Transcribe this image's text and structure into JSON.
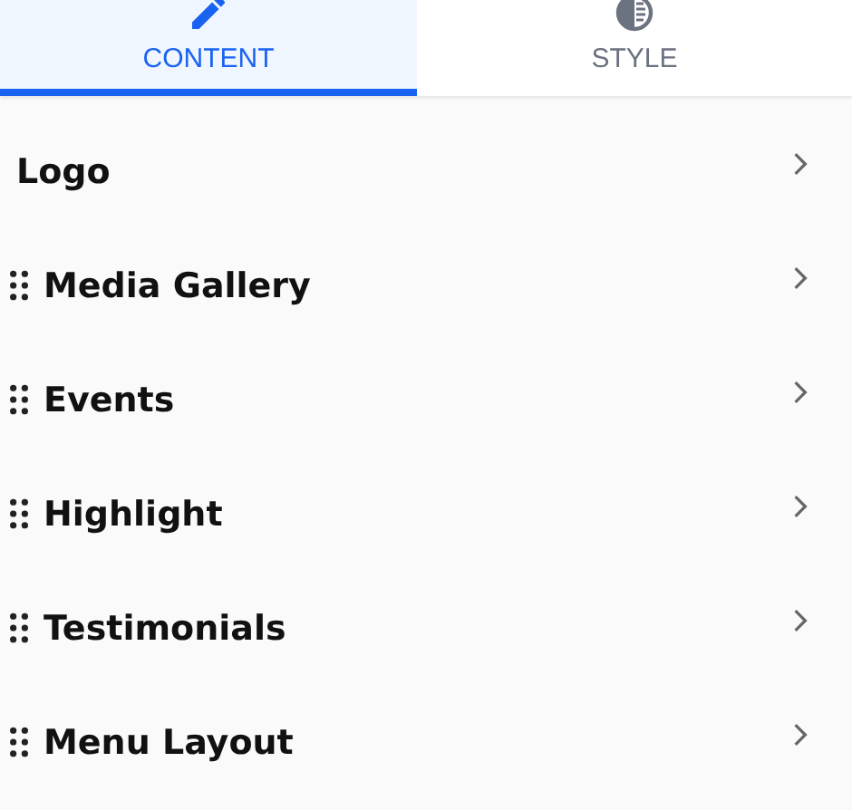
{
  "tabs": [
    {
      "label": "CONTENT",
      "selected": true,
      "kind": "pencil"
    },
    {
      "label": "STYLE",
      "selected": false,
      "kind": "contrast"
    }
  ],
  "items": [
    {
      "label": "Logo",
      "draggable": false
    },
    {
      "label": "Media Gallery",
      "draggable": true
    },
    {
      "label": "Events",
      "draggable": true
    },
    {
      "label": "Highlight",
      "draggable": true
    },
    {
      "label": "Testimonials",
      "draggable": true
    },
    {
      "label": "Menu Layout",
      "draggable": true
    }
  ]
}
